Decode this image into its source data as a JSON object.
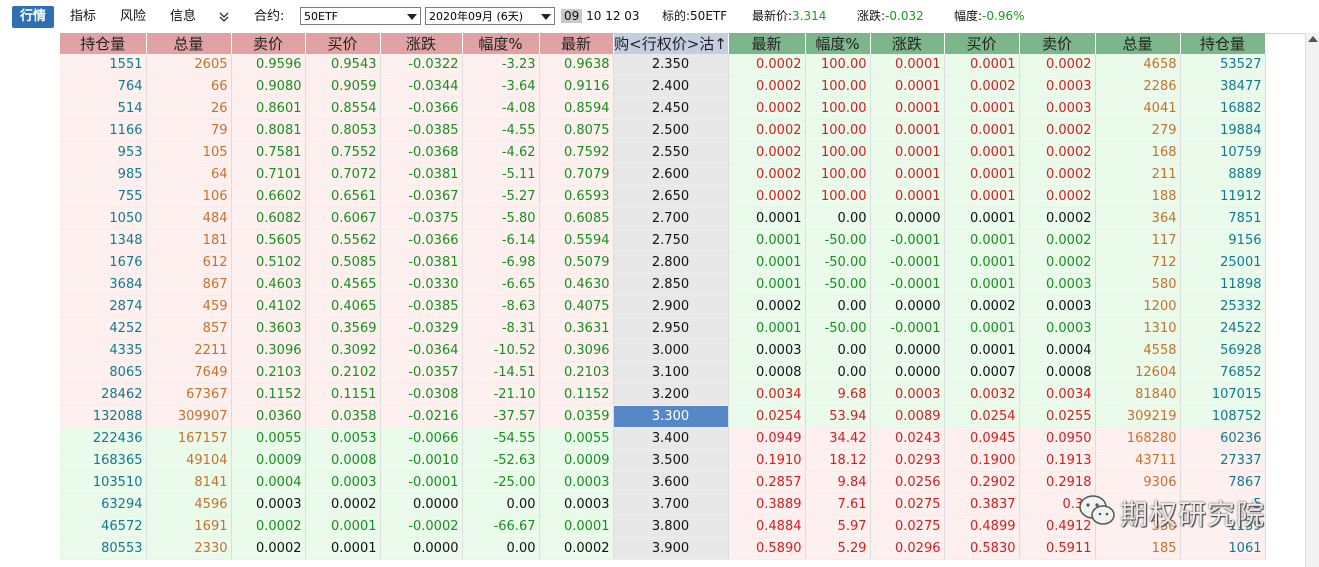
{
  "toolbar": {
    "tabs": [
      "行情",
      "指标",
      "风险",
      "信息"
    ],
    "expand_icon": "double-chevron-down-icon",
    "contract_label": "合约:",
    "contract_value": "50ETF",
    "month_value": "2020年09月 (6天)",
    "date_highlight": "09",
    "date_rest": "10 12 03",
    "underlying_label": "标的:50ETF",
    "last_label": "最新价:",
    "last_value": "3.314",
    "change_label": "涨跌:",
    "change_value": "-0.032",
    "pct_label": "幅度:",
    "pct_value": "-0.96%"
  },
  "headers": {
    "call": [
      "持仓量",
      "总量",
      "卖价",
      "买价",
      "涨跌",
      "幅度%",
      "最新"
    ],
    "strike": "购<行权价>沽↑",
    "put": [
      "最新",
      "幅度%",
      "涨跌",
      "买价",
      "卖价",
      "总量",
      "持仓量"
    ]
  },
  "atm_strike": "3.300",
  "rows": [
    {
      "c": [
        "1551",
        "2605",
        "0.9596",
        "0.9543",
        "-0.0322",
        "-3.23",
        "0.9638"
      ],
      "k": "2.350",
      "p": [
        "0.0002",
        "100.00",
        "0.0001",
        "0.0001",
        "0.0002",
        "4658",
        "53527"
      ],
      "pd": "up"
    },
    {
      "c": [
        "764",
        "66",
        "0.9080",
        "0.9059",
        "-0.0344",
        "-3.64",
        "0.9116"
      ],
      "k": "2.400",
      "p": [
        "0.0002",
        "100.00",
        "0.0001",
        "0.0002",
        "0.0003",
        "2286",
        "38477"
      ],
      "pd": "up"
    },
    {
      "c": [
        "514",
        "26",
        "0.8601",
        "0.8554",
        "-0.0366",
        "-4.08",
        "0.8594"
      ],
      "k": "2.450",
      "p": [
        "0.0002",
        "100.00",
        "0.0001",
        "0.0001",
        "0.0003",
        "4041",
        "16882"
      ],
      "pd": "up"
    },
    {
      "c": [
        "1166",
        "79",
        "0.8081",
        "0.8053",
        "-0.0385",
        "-4.55",
        "0.8075"
      ],
      "k": "2.500",
      "p": [
        "0.0002",
        "100.00",
        "0.0001",
        "0.0001",
        "0.0002",
        "279",
        "19884"
      ],
      "pd": "up"
    },
    {
      "c": [
        "953",
        "105",
        "0.7581",
        "0.7552",
        "-0.0368",
        "-4.62",
        "0.7592"
      ],
      "k": "2.550",
      "p": [
        "0.0002",
        "100.00",
        "0.0001",
        "0.0001",
        "0.0002",
        "168",
        "10759"
      ],
      "pd": "up"
    },
    {
      "c": [
        "985",
        "64",
        "0.7101",
        "0.7072",
        "-0.0381",
        "-5.11",
        "0.7079"
      ],
      "k": "2.600",
      "p": [
        "0.0002",
        "100.00",
        "0.0001",
        "0.0001",
        "0.0002",
        "211",
        "8889"
      ],
      "pd": "up"
    },
    {
      "c": [
        "755",
        "106",
        "0.6602",
        "0.6561",
        "-0.0367",
        "-5.27",
        "0.6593"
      ],
      "k": "2.650",
      "p": [
        "0.0002",
        "100.00",
        "0.0001",
        "0.0001",
        "0.0002",
        "188",
        "11912"
      ],
      "pd": "up"
    },
    {
      "c": [
        "1050",
        "484",
        "0.6082",
        "0.6067",
        "-0.0375",
        "-5.80",
        "0.6085"
      ],
      "k": "2.700",
      "p": [
        "0.0001",
        "0.00",
        "0.0000",
        "0.0001",
        "0.0002",
        "364",
        "7851"
      ],
      "pd": "flat"
    },
    {
      "c": [
        "1348",
        "181",
        "0.5605",
        "0.5562",
        "-0.0366",
        "-6.14",
        "0.5594"
      ],
      "k": "2.750",
      "p": [
        "0.0001",
        "-50.00",
        "-0.0001",
        "0.0001",
        "0.0002",
        "117",
        "9156"
      ],
      "pd": "down"
    },
    {
      "c": [
        "1676",
        "612",
        "0.5102",
        "0.5085",
        "-0.0381",
        "-6.98",
        "0.5079"
      ],
      "k": "2.800",
      "p": [
        "0.0001",
        "-50.00",
        "-0.0001",
        "0.0001",
        "0.0002",
        "712",
        "25001"
      ],
      "pd": "down"
    },
    {
      "c": [
        "3684",
        "867",
        "0.4603",
        "0.4565",
        "-0.0330",
        "-6.65",
        "0.4630"
      ],
      "k": "2.850",
      "p": [
        "0.0001",
        "-50.00",
        "-0.0001",
        "0.0001",
        "0.0003",
        "580",
        "11898"
      ],
      "pd": "down"
    },
    {
      "c": [
        "2874",
        "459",
        "0.4102",
        "0.4065",
        "-0.0385",
        "-8.63",
        "0.4075"
      ],
      "k": "2.900",
      "p": [
        "0.0002",
        "0.00",
        "0.0000",
        "0.0002",
        "0.0003",
        "1200",
        "25332"
      ],
      "pd": "flat"
    },
    {
      "c": [
        "4252",
        "857",
        "0.3603",
        "0.3569",
        "-0.0329",
        "-8.31",
        "0.3631"
      ],
      "k": "2.950",
      "p": [
        "0.0001",
        "-50.00",
        "-0.0001",
        "0.0001",
        "0.0003",
        "1310",
        "24522"
      ],
      "pd": "down"
    },
    {
      "c": [
        "4335",
        "2211",
        "0.3096",
        "0.3092",
        "-0.0364",
        "-10.52",
        "0.3096"
      ],
      "k": "3.000",
      "p": [
        "0.0003",
        "0.00",
        "0.0000",
        "0.0001",
        "0.0004",
        "4558",
        "56928"
      ],
      "pd": "flat"
    },
    {
      "c": [
        "8065",
        "7649",
        "0.2103",
        "0.2102",
        "-0.0357",
        "-14.51",
        "0.2103"
      ],
      "k": "3.100",
      "p": [
        "0.0008",
        "0.00",
        "0.0000",
        "0.0007",
        "0.0008",
        "12604",
        "76852"
      ],
      "pd": "flat"
    },
    {
      "c": [
        "28462",
        "67367",
        "0.1152",
        "0.1151",
        "-0.0308",
        "-21.10",
        "0.1152"
      ],
      "k": "3.200",
      "p": [
        "0.0034",
        "9.68",
        "0.0003",
        "0.0032",
        "0.0034",
        "81840",
        "107015"
      ],
      "pd": "up"
    },
    {
      "c": [
        "132088",
        "309907",
        "0.0360",
        "0.0358",
        "-0.0216",
        "-37.57",
        "0.0359"
      ],
      "k": "3.300",
      "p": [
        "0.0254",
        "53.94",
        "0.0089",
        "0.0254",
        "0.0255",
        "309219",
        "108752"
      ],
      "pd": "up"
    },
    {
      "c": [
        "222436",
        "167157",
        "0.0055",
        "0.0053",
        "-0.0066",
        "-54.55",
        "0.0055"
      ],
      "k": "3.400",
      "p": [
        "0.0949",
        "34.42",
        "0.0243",
        "0.0945",
        "0.0950",
        "168280",
        "60236"
      ],
      "pd": "up"
    },
    {
      "c": [
        "168365",
        "49104",
        "0.0009",
        "0.0008",
        "-0.0010",
        "-52.63",
        "0.0009"
      ],
      "k": "3.500",
      "p": [
        "0.1910",
        "18.12",
        "0.0293",
        "0.1900",
        "0.1913",
        "43711",
        "27337"
      ],
      "pd": "up"
    },
    {
      "c": [
        "103510",
        "8141",
        "0.0004",
        "0.0003",
        "-0.0001",
        "-25.00",
        "0.0003"
      ],
      "k": "3.600",
      "p": [
        "0.2857",
        "9.84",
        "0.0256",
        "0.2902",
        "0.2918",
        "9306",
        "7867"
      ],
      "pd": "up"
    },
    {
      "c": [
        "63294",
        "4596",
        "0.0003",
        "0.0002",
        "0.0000",
        "0.00",
        "0.0003"
      ],
      "k": "3.700",
      "p": [
        "0.3889",
        "7.61",
        "0.0275",
        "0.3837",
        "0.39",
        "",
        "5"
      ],
      "pd": "up"
    },
    {
      "c": [
        "46572",
        "1691",
        "0.0002",
        "0.0001",
        "-0.0002",
        "-66.67",
        "0.0001"
      ],
      "k": "3.800",
      "p": [
        "0.4884",
        "5.97",
        "0.0275",
        "0.4899",
        "0.4912",
        "330",
        "1139"
      ],
      "pd": "up"
    },
    {
      "c": [
        "80553",
        "2330",
        "0.0002",
        "0.0001",
        "0.0000",
        "0.00",
        "0.0002"
      ],
      "k": "3.900",
      "p": [
        "0.5890",
        "5.29",
        "0.0296",
        "0.5830",
        "0.5911",
        "185",
        "1061"
      ],
      "pd": "up"
    }
  ],
  "watermark": {
    "text": "期权研究院",
    "icon": "wechat-icon"
  },
  "scrollbar": {
    "up_icon": "scroll-up-arrow-icon"
  }
}
